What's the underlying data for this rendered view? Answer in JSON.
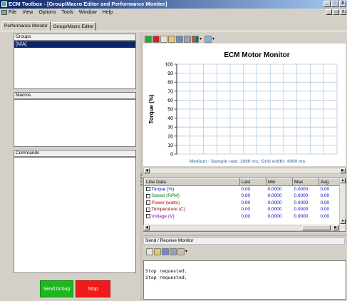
{
  "window": {
    "title": "ECM Toolbox - [Group/Macro Editor and Performance Monitor]",
    "controls": [
      "_",
      "□",
      "X"
    ]
  },
  "menu": [
    "File",
    "View",
    "Options",
    "Tools",
    "Window",
    "Help"
  ],
  "mdi_controls": [
    "_",
    "□",
    "X"
  ],
  "tabs": [
    {
      "label": "Performance Monitor",
      "active": true
    },
    {
      "label": "Group/Macro Editor",
      "active": false
    }
  ],
  "left": {
    "groups_label": "Groups",
    "groups_items": [
      "[N/A]"
    ],
    "macros_label": "Macros",
    "commands_label": "Commands",
    "send_group_label": "Send Group",
    "stop_label": "Stop"
  },
  "chart_toolbar_icons": [
    "run-icon",
    "stop-icon",
    "refresh-icon",
    "open-folder-icon",
    "save-icon",
    "print-icon",
    "chart-type-icon",
    "dropdown-arrow",
    "zoom-icon",
    "dropdown-arrow"
  ],
  "chart_data": {
    "type": "line",
    "title": "ECM Motor Monitor",
    "ylabel": "Torque (%)",
    "xlabel": "Medium - Sample rate: 1000 ms; Grid width: 4000 ms",
    "ylim": [
      0,
      100
    ],
    "yticks": [
      0,
      10,
      20,
      30,
      40,
      50,
      60,
      70,
      80,
      90,
      100
    ],
    "grid": true,
    "series": []
  },
  "line_table": {
    "headers": [
      "Line Data",
      "Last",
      "Min",
      "Max",
      "Avg"
    ],
    "rows": [
      {
        "name": "Torque (%)",
        "color": "#0000c0",
        "last": "0.00",
        "min": "0.0000",
        "max": "0.0000",
        "avg": "0.00"
      },
      {
        "name": "Speed (RPM)",
        "color": "#008000",
        "last": "0.00",
        "min": "0.0000",
        "max": "0.0000",
        "avg": "0.00"
      },
      {
        "name": "Power (watts)",
        "color": "#c00000",
        "last": "0.00",
        "min": "0.0000",
        "max": "0.0000",
        "avg": "0.00"
      },
      {
        "name": "Temperature (C)",
        "color": "#800000",
        "last": "0.00",
        "min": "0.0000",
        "max": "0.0000",
        "avg": "0.00"
      },
      {
        "name": "Voltage (V)",
        "color": "#8000c0",
        "last": "0.00",
        "min": "0.0000",
        "max": "0.0000",
        "avg": "0.00"
      }
    ]
  },
  "send_receive": {
    "label": "Send / Receive Monitor",
    "toolbar_icons": [
      "refresh-icon",
      "open-folder-icon",
      "save-icon",
      "print-icon",
      "settings-icon",
      "dropdown-arrow"
    ],
    "log_lines": [
      "Stop requested.",
      "Stop requested."
    ]
  },
  "colors": {
    "titlebar_start": "#0a246a",
    "titlebar_end": "#a6caf0",
    "send_button": "#1eb81e",
    "stop_button": "#ef1b1b",
    "selection": "#0a246a",
    "chart_grid": "#b4c8dc",
    "chart_caption": "#6a8fc0"
  }
}
